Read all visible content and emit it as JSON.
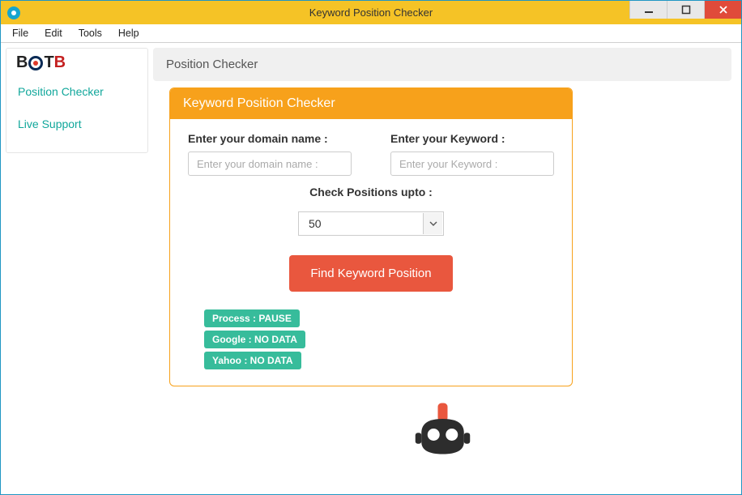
{
  "window": {
    "title": "Keyword Position Checker"
  },
  "menu": {
    "file": "File",
    "edit": "Edit",
    "tools": "Tools",
    "help": "Help"
  },
  "sidebar": {
    "items": [
      {
        "label": "Position Checker"
      },
      {
        "label": "Live Support"
      }
    ]
  },
  "breadcrumb": {
    "text": "Position Checker"
  },
  "card": {
    "title": "Keyword Position Checker",
    "domain_label": "Enter your domain name :",
    "domain_placeholder": "Enter your domain name :",
    "keyword_label": "Enter your Keyword :",
    "keyword_placeholder": "Enter your Keyword :",
    "positions_label": "Check Positions upto :",
    "positions_selected": "50",
    "submit_label": "Find Keyword Position",
    "badges": {
      "process": "Process : PAUSE",
      "google": "Google : NO DATA",
      "yahoo": "Yahoo : NO DATA"
    }
  }
}
